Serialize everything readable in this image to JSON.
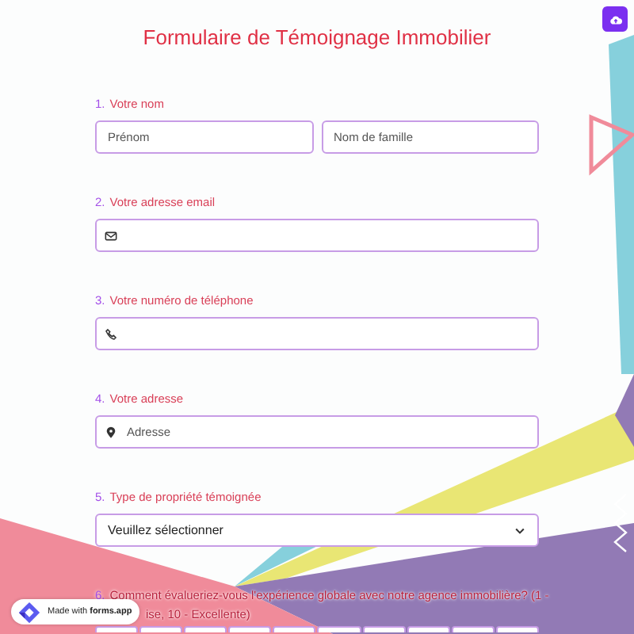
{
  "title": "Formulaire de Témoignage Immobilier",
  "questions": [
    {
      "number": "1.",
      "label": "Votre nom",
      "kind": "name",
      "fields": [
        {
          "placeholder": "Prénom"
        },
        {
          "placeholder": "Nom de famille"
        }
      ]
    },
    {
      "number": "2.",
      "label": "Votre adresse email",
      "kind": "email"
    },
    {
      "number": "3.",
      "label": "Votre numéro de téléphone",
      "kind": "phone"
    },
    {
      "number": "4.",
      "label": "Votre adresse",
      "kind": "address",
      "fields": [
        {
          "placeholder": "Adresse"
        }
      ]
    },
    {
      "number": "5.",
      "label": "Type de propriété témoignée",
      "kind": "select",
      "fields": [
        {
          "value": "Veuillez sélectionner"
        }
      ]
    },
    {
      "number": "6.",
      "label": "Comment évalueriez-vous l'expérience globale avec notre agence immobilière? (1 -",
      "label_end": "ise, 10 - Excellente)",
      "kind": "rating",
      "fields": [
        {
          "kind": "cell"
        },
        {
          "kind": "cell"
        },
        {
          "kind": "cell"
        },
        {
          "kind": "cell"
        },
        {
          "kind": "cell"
        },
        {
          "kind": "cell"
        },
        {
          "kind": "cell"
        },
        {
          "kind": "cell"
        },
        {
          "kind": "cell"
        },
        {
          "kind": "cell"
        }
      ]
    }
  ],
  "badge": "Made with **forms.app**"
}
